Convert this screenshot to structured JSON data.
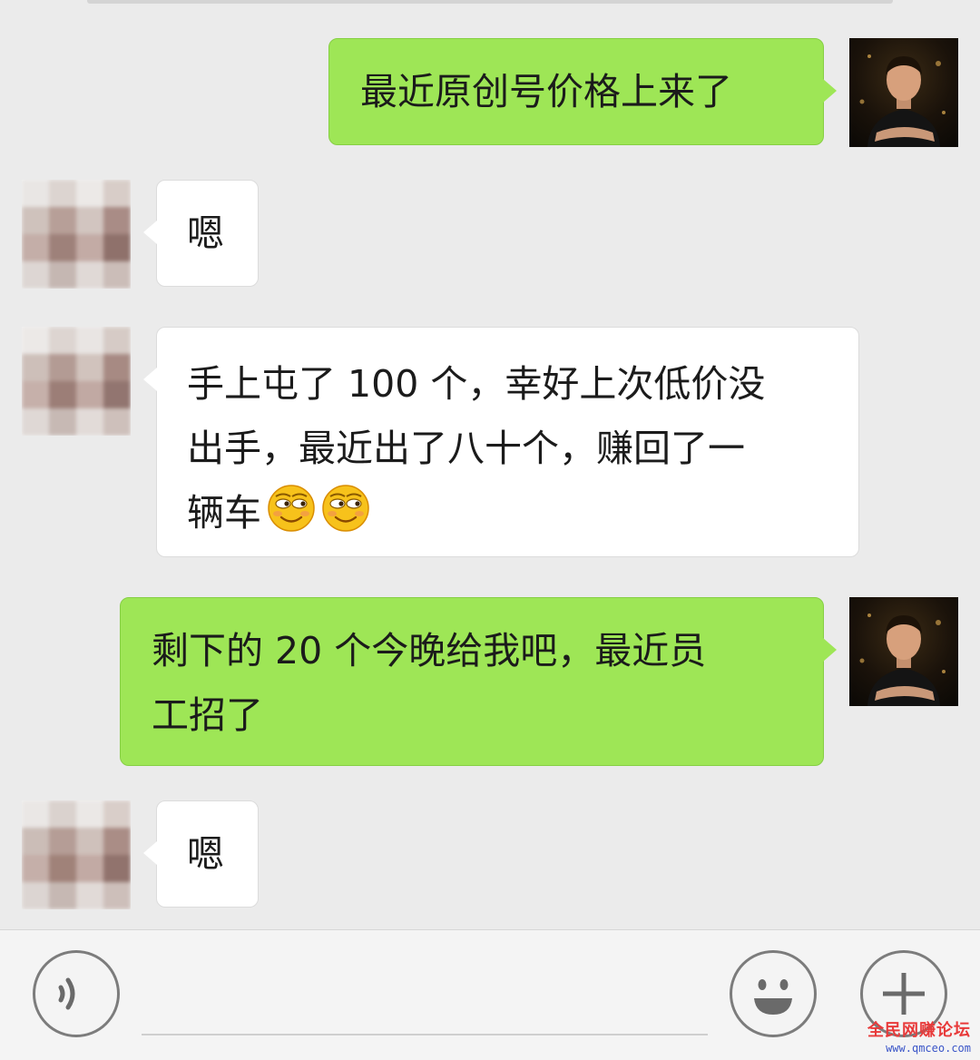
{
  "conversation": {
    "messages": [
      {
        "sender": "self",
        "text": "最近原创号价格上来了"
      },
      {
        "sender": "other",
        "text": "嗯"
      },
      {
        "sender": "other",
        "lines": [
          "手上屯了 100 个，幸好上次低价没",
          "出手，最近出了八十个，赚回了一",
          "辆车"
        ],
        "emoji": [
          "smirk-emoji",
          "smirk-emoji"
        ]
      },
      {
        "sender": "self",
        "lines": [
          "剩下的 20 个今晚给我吧，最近员",
          "工招了"
        ]
      },
      {
        "sender": "other",
        "text": "嗯"
      }
    ]
  },
  "input_bar": {
    "voice_icon": "voice-icon",
    "emoji_icon": "emoji-face-icon",
    "plus_icon": "plus-icon"
  },
  "watermark": {
    "name": "全民网赚论坛",
    "url": "www.qmceo.com"
  },
  "colors": {
    "chat_background": "#ebebeb",
    "self_bubble": "#9ee656",
    "other_bubble": "#ffffff",
    "watermark_red": "#e83a3a",
    "watermark_blue": "#3a55c8"
  }
}
